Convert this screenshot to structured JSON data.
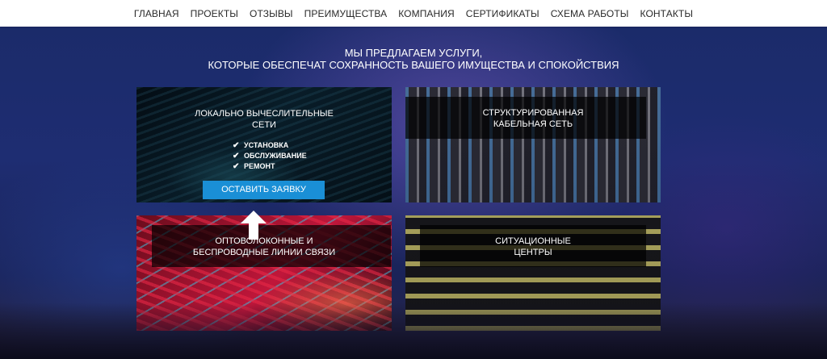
{
  "nav": {
    "items": [
      "ГЛАВНАЯ",
      "ПРОЕКТЫ",
      "ОТЗЫВЫ",
      "ПРЕИМУЩЕСТВА",
      "КОМПАНИЯ",
      "СЕРТИФИКАТЫ",
      "СХЕМА РАБОТЫ",
      "КОНТАКТЫ"
    ]
  },
  "hero": {
    "title_line1": "МЫ ПРЕДЛАГАЕМ УСЛУГИ,",
    "title_line2": "КОТОРЫЕ ОБЕСПЕЧАТ СОХРАННОСТЬ ВАШЕГО ИМУЩЕСТВА И СПОКОЙСТВИЯ"
  },
  "cards": [
    {
      "title_line1": "ЛОКАЛЬНО ВЫЧЕСЛИТЕЛЬНЫЕ",
      "title_line2": "СЕТИ",
      "features": [
        "УСТАНОВКА",
        "ОБСЛУЖИВАНИЕ",
        "РЕМОНТ"
      ],
      "button": "ОСТАВИТЬ ЗАЯВКУ"
    },
    {
      "title_line1": "СТРУКТУРИРОВАННАЯ",
      "title_line2": "КАБЕЛЬНАЯ СЕТЬ"
    },
    {
      "title_line1": "ОПТОВОЛОКОННЫЕ И",
      "title_line2": "БЕСПРОВОДНЫЕ ЛИНИИ СВЯЗИ"
    },
    {
      "title_line1": "СИТУАЦИОННЫЕ",
      "title_line2": "ЦЕНТРЫ"
    }
  ],
  "colors": {
    "accent_button": "#1a8fd6",
    "nav_bg": "#ffffff",
    "nav_text": "#2a2a2a"
  },
  "icons": {
    "check": "check-icon",
    "cursor": "arrow-up-cursor-icon"
  }
}
